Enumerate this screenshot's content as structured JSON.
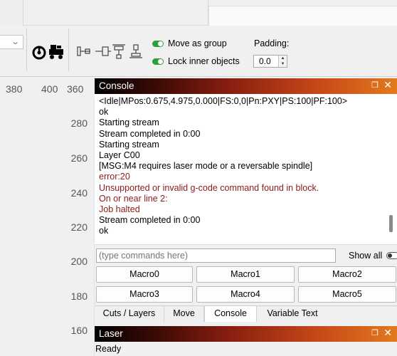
{
  "toolbar": {
    "move_as_group_label": "Move as group",
    "lock_inner_objects_label": "Lock inner objects",
    "padding_label": "Padding:",
    "padding_value": "0.0",
    "accent_green": "#2aa03a",
    "icons": [
      "rotate-left-icon",
      "vehicle-icon",
      "align-distribute-horizontal-icon",
      "align-distribute-spacing-icon",
      "align-top-center-icon",
      "align-bottom-icon"
    ]
  },
  "ruler": {
    "top": [
      "380",
      "400",
      "360"
    ],
    "left": [
      "280",
      "260",
      "240",
      "220",
      "200",
      "180",
      "160"
    ]
  },
  "console": {
    "title": "Console",
    "lines": [
      {
        "text": "<Idle|MPos:0.675,4.975,0.000|FS:0,0|Pn:PXY|PS:100|PF:100>",
        "error": false
      },
      {
        "text": "ok",
        "error": false
      },
      {
        "text": "Starting stream",
        "error": false
      },
      {
        "text": "Stream completed in 0:00",
        "error": false
      },
      {
        "text": "Starting stream",
        "error": false
      },
      {
        "text": "Layer C00",
        "error": false
      },
      {
        "text": "[MSG:M4 requires laser mode or a reversable spindle]",
        "error": false
      },
      {
        "text": "error:20",
        "error": true
      },
      {
        "text": "Unsupported or invalid g-code command found in block.",
        "error": true
      },
      {
        "text": "On or near line 2:",
        "error": true
      },
      {
        "text": "Job halted",
        "error": true
      },
      {
        "text": "Stream completed in 0:00",
        "error": false
      },
      {
        "text": "ok",
        "error": false
      }
    ],
    "command_placeholder": "(type commands here)",
    "show_all_label": "Show all",
    "macros": [
      "Macro0",
      "Macro1",
      "Macro2",
      "Macro3",
      "Macro4",
      "Macro5"
    ],
    "error_color": "#8b1a1a"
  },
  "tabs": [
    {
      "label": "Cuts / Layers",
      "active": false
    },
    {
      "label": "Move",
      "active": false
    },
    {
      "label": "Console",
      "active": true
    },
    {
      "label": "Variable Text",
      "active": false
    }
  ],
  "laser": {
    "title": "Laser",
    "status": "Ready"
  }
}
